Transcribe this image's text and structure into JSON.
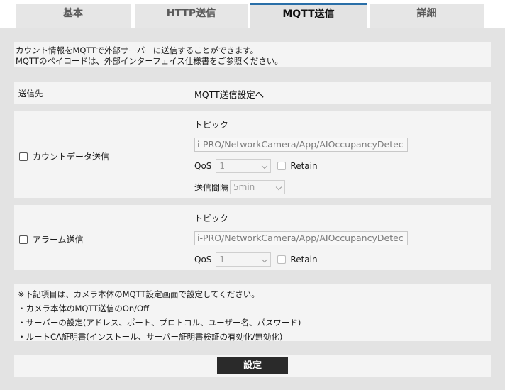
{
  "tabs": [
    {
      "label": "基本"
    },
    {
      "label": "HTTP送信"
    },
    {
      "label": "MQTT送信"
    },
    {
      "label": "詳細"
    }
  ],
  "intro": {
    "line1": "カウント情報をMQTTで外部サーバーに送信することができます。",
    "line2": "MQTTのペイロードは、外部インターフェイス仕様書をご参照ください。"
  },
  "destination": {
    "label": "送信先",
    "link": "MQTT送信設定へ"
  },
  "count_data": {
    "checkbox_label": "カウントデータ送信",
    "topic_label": "トピック",
    "topic_value": "i-PRO/NetworkCamera/App/AIOccupancyDetec",
    "qos_label": "QoS",
    "qos_value": "1",
    "retain_label": "Retain",
    "interval_label": "送信間隔",
    "interval_value": "5min"
  },
  "alarm": {
    "checkbox_label": "アラーム送信",
    "topic_label": "トピック",
    "topic_value": "i-PRO/NetworkCamera/App/AIOccupancyDetec",
    "qos_label": "QoS",
    "qos_value": "1",
    "retain_label": "Retain"
  },
  "notes": {
    "heading": "※下記項目は、カメラ本体のMQTT設定画面で設定してください。",
    "items": [
      "・カメラ本体のMQTT送信のOn/Off",
      "・サーバーの設定(アドレス、ポート、プロトコル、ユーザー名、パスワード)",
      "・ルートCA証明書(インストール、サーバー証明書検証の有効化/無効化)"
    ]
  },
  "footer": {
    "submit_label": "設定"
  },
  "colors": {
    "active_tab_border": "#2a6fa8",
    "panel_bg": "#e3e3e3",
    "button_bg": "#2a2a2a"
  }
}
